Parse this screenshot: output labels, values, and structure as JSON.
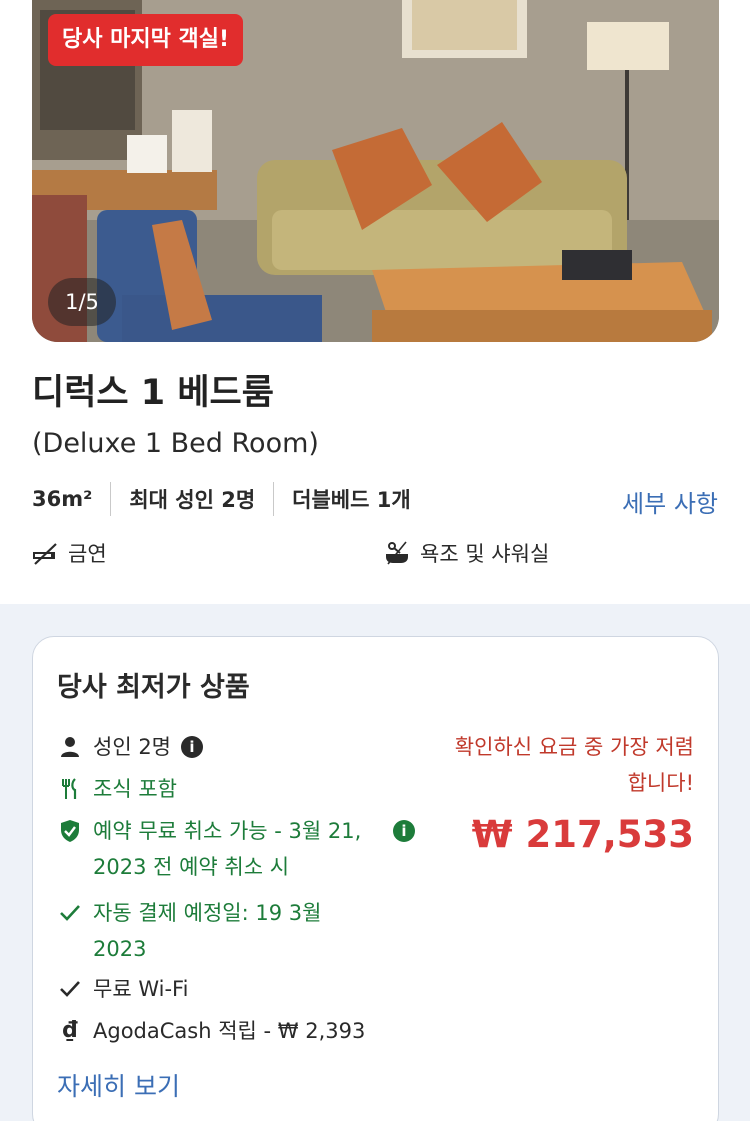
{
  "photo": {
    "badge": "당사 마지막 객실!",
    "counter": "1/5"
  },
  "room": {
    "title": "디럭스 1 베드룸",
    "subtitle": "(Deluxe 1 Bed Room)",
    "specs": [
      "36m²",
      "최대 성인 2명",
      "더블베드 1개"
    ],
    "details_link": "세부 사항",
    "amenities": [
      {
        "icon": "no-smoking-icon",
        "label": "금연"
      },
      {
        "icon": "bathtub-shower-icon",
        "label": "욕조 및 샤워실"
      }
    ]
  },
  "offer": {
    "title": "당사 최저가 상품",
    "features": {
      "adults": "성인 2명",
      "breakfast": "조식 포함",
      "cancel": "예약 무료 취소 가능 - 3월 21, 2023 전 예약 취소 시",
      "autopay": "자동 결제 예정일: 19 3월 2023",
      "wifi": "무료 Wi-Fi",
      "agodacash": "AgodaCash 적립 - ₩ 2,393"
    },
    "price_note": "확인하신 요금 중 가장 저렴합니다!",
    "price": "₩ 217,533",
    "see_more": "자세히 보기"
  },
  "colors": {
    "badge_red": "#e12d2d",
    "link_blue": "#3b6eb5",
    "green": "#1d7c3a",
    "price_red": "#d93b3b"
  }
}
